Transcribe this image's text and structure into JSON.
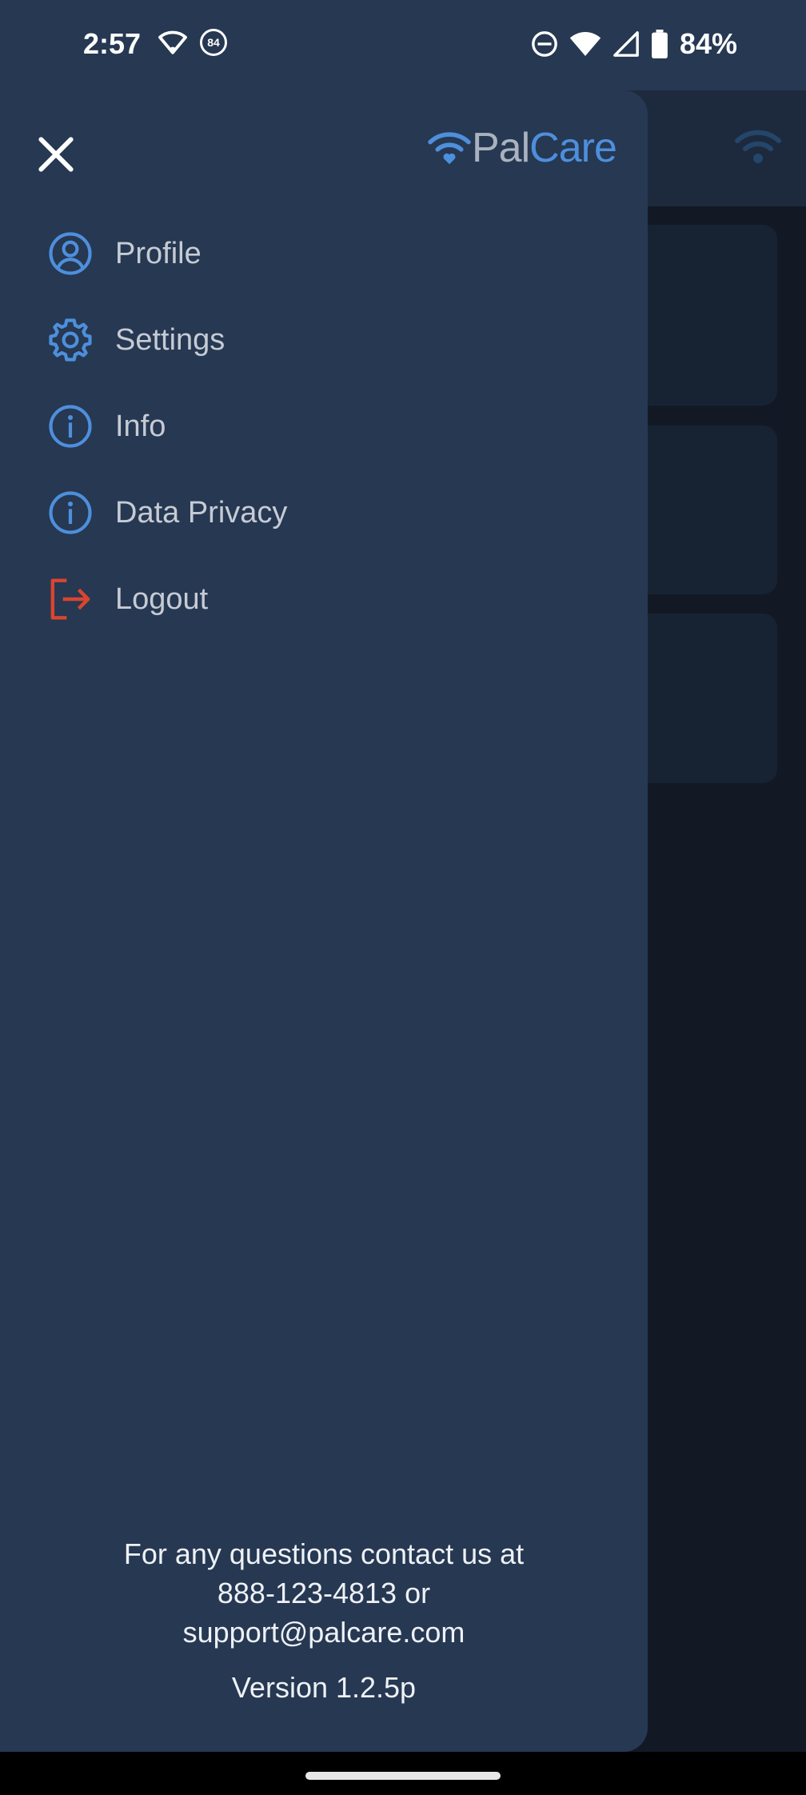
{
  "status_bar": {
    "time": "2:57",
    "notification_badge": "84",
    "battery_percent": "84%"
  },
  "brand": {
    "name_part1": "Pal",
    "name_part2": "Care",
    "colors": {
      "accent": "#4e8fdc",
      "logout": "#d9452f",
      "drawer_bg": "#263852"
    }
  },
  "drawer": {
    "close_icon": "close-icon",
    "menu": [
      {
        "label": "Profile",
        "icon": "profile-icon"
      },
      {
        "label": "Settings",
        "icon": "gear-icon"
      },
      {
        "label": "Info",
        "icon": "info-icon"
      },
      {
        "label": "Data Privacy",
        "icon": "info-icon"
      },
      {
        "label": "Logout",
        "icon": "logout-icon"
      }
    ],
    "footer": {
      "contact_line1": "For any questions contact us at",
      "contact_line2": "888-123-4813 or",
      "contact_line3": "support@palcare.com",
      "version": "Version 1.2.5p"
    }
  }
}
